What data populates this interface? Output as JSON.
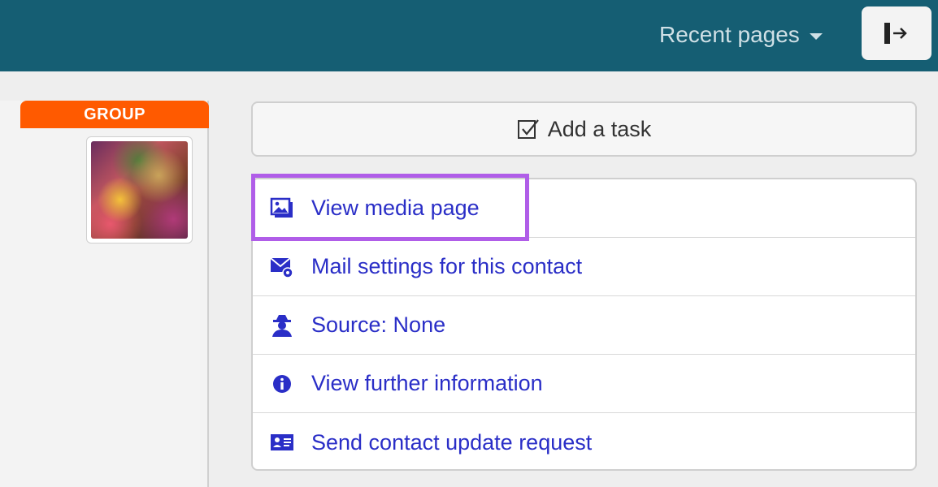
{
  "header": {
    "recent_pages_label": "Recent pages",
    "logout_icon": "logout-icon"
  },
  "left_panel": {
    "group_label": "GROUP"
  },
  "actions": {
    "add_task_label": "Add a task",
    "items": [
      {
        "label": "View media page",
        "icon": "media-icon"
      },
      {
        "label": "Mail settings for this contact",
        "icon": "mail-settings-icon"
      },
      {
        "label": "Source: None",
        "icon": "spy-icon"
      },
      {
        "label": "View further information",
        "icon": "info-icon"
      },
      {
        "label": "Send contact update request",
        "icon": "contact-card-icon"
      }
    ]
  },
  "colors": {
    "topbar": "#155e73",
    "group_tab": "#ff5a00",
    "link": "#2a2ec7",
    "highlight": "#b05de8"
  }
}
